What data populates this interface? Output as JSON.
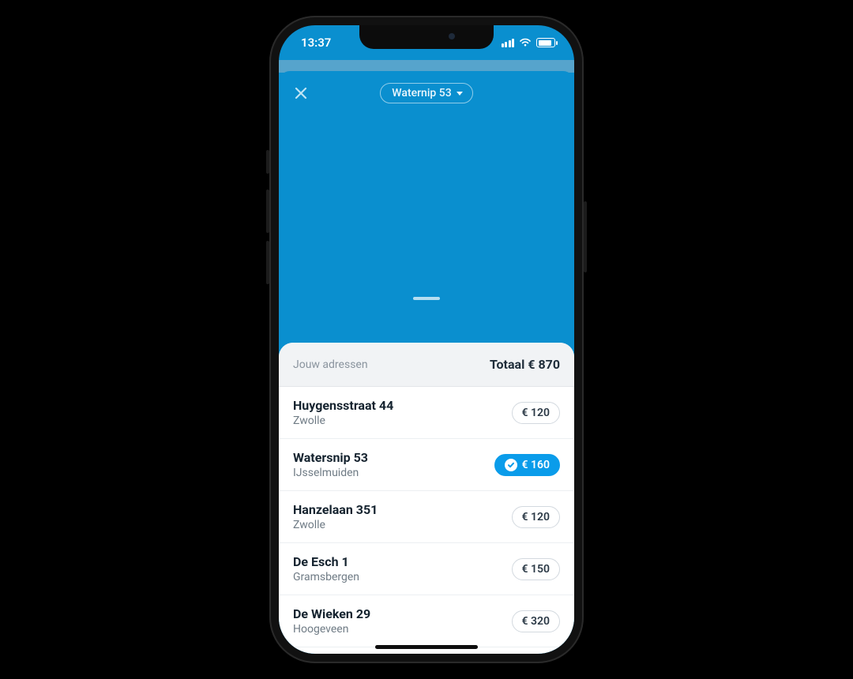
{
  "status": {
    "time": "13:37"
  },
  "header": {
    "selected_address": "Waternip 53"
  },
  "panel": {
    "label": "Jouw adressen",
    "total_label": "Totaal € 870"
  },
  "addresses": [
    {
      "title": "Huygensstraat 44",
      "city": "Zwolle",
      "amount": "€ 120",
      "selected": false
    },
    {
      "title": "Watersnip 53",
      "city": "IJsselmuiden",
      "amount": "€ 160",
      "selected": true
    },
    {
      "title": "Hanzelaan 351",
      "city": "Zwolle",
      "amount": "€ 120",
      "selected": false
    },
    {
      "title": "De Esch 1",
      "city": "Gramsbergen",
      "amount": "€ 150",
      "selected": false
    },
    {
      "title": "De Wieken 29",
      "city": "Hoogeveen",
      "amount": "€ 320",
      "selected": false
    }
  ]
}
